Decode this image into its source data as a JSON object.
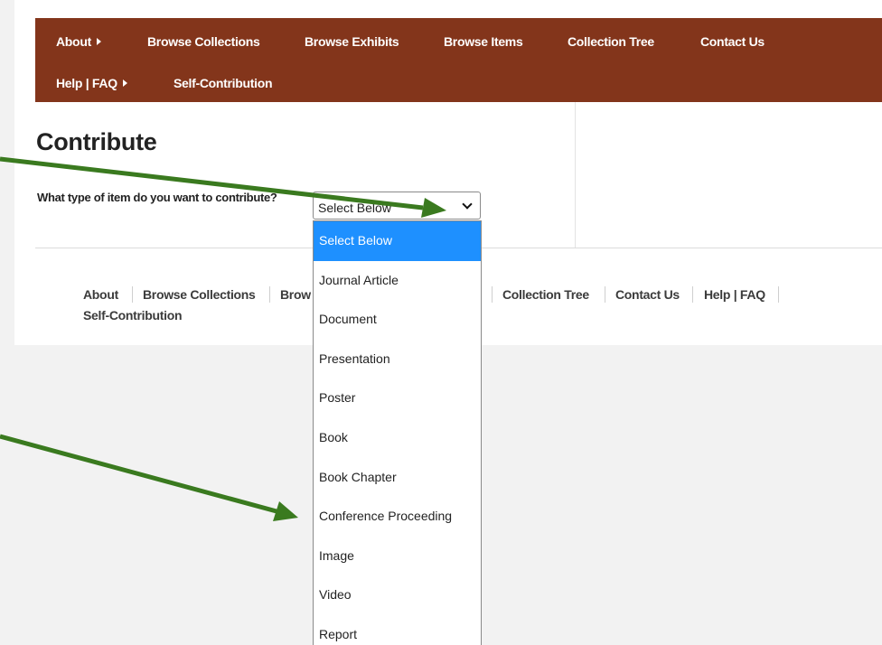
{
  "nav": {
    "items": [
      {
        "label": "About",
        "has_submenu": true
      },
      {
        "label": "Browse Collections",
        "has_submenu": false
      },
      {
        "label": "Browse Exhibits",
        "has_submenu": false
      },
      {
        "label": "Browse Items",
        "has_submenu": false
      },
      {
        "label": "Collection Tree",
        "has_submenu": false
      },
      {
        "label": "Contact Us",
        "has_submenu": false
      },
      {
        "label": "Help | FAQ",
        "has_submenu": true
      },
      {
        "label": "Self-Contribution",
        "has_submenu": false
      }
    ],
    "background_color": "#83351b"
  },
  "page": {
    "title": "Contribute",
    "question_label": "What type of item do you want to contribute?"
  },
  "item_type_select": {
    "selected": "Select Below",
    "options": [
      "Select Below",
      "Journal Article",
      "Document",
      "Presentation",
      "Poster",
      "Book",
      "Book Chapter",
      "Conference Proceeding",
      "Image",
      "Video",
      "Report"
    ],
    "highlight_color": "#1e90ff"
  },
  "footer": {
    "links": [
      "About",
      "Browse Collections",
      "Brow",
      "Collection Tree",
      "Contact Us",
      "Help | FAQ",
      "Self-Contribution"
    ]
  },
  "annotations": {
    "arrow_color": "#3a7a1f"
  }
}
